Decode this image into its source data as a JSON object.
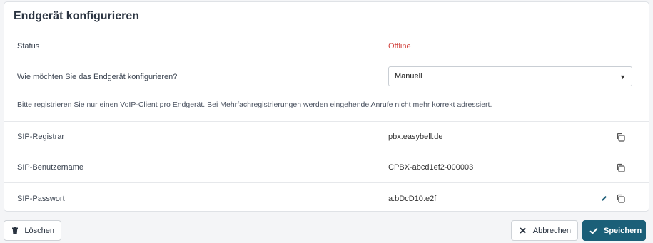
{
  "card": {
    "title": "Endgerät konfigurieren"
  },
  "status": {
    "label": "Status",
    "value": "Offline",
    "color": "#d03b36"
  },
  "config": {
    "question": "Wie möchten Sie das Endgerät konfigurieren?",
    "selected": "Manuell",
    "note": "Bitte registrieren Sie nur einen VoIP-Client pro Endgerät. Bei Mehrfachregistrierungen werden eingehende Anrufe nicht mehr korrekt adressiert."
  },
  "sip": [
    {
      "label": "SIP-Registrar",
      "value": "pbx.easybell.de"
    },
    {
      "label": "SIP-Benutzername",
      "value": "CPBX-abcd1ef2-000003"
    },
    {
      "label": "SIP-Passwort",
      "value": "a.bDcD10.e2f"
    }
  ],
  "icons": {
    "copy": "copy-icon",
    "edit": "pencil-icon",
    "trash": "trash-icon",
    "close": "close-icon",
    "check": "check-icon",
    "caret": "caret-down-icon"
  },
  "buttons": {
    "delete": "Löschen",
    "cancel": "Abbrechen",
    "save": "Speichern"
  },
  "colors": {
    "primary": "#1b5f78",
    "offline": "#d03b36"
  }
}
